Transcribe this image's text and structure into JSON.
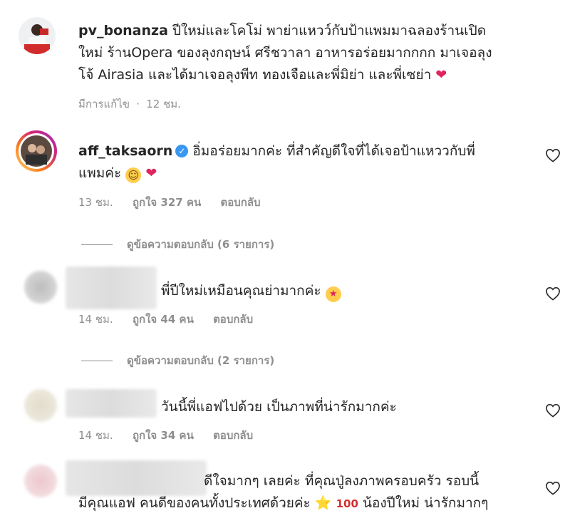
{
  "comments": [
    {
      "username": "pv_bonanza",
      "text_lines": [
        "ปีใหม่และโคโม่ พาย่าแหวว์กับป้าแพมมาฉลองร้านเปิด",
        "ใหม่ ร้านOpera ของลุงกฤษน์ ศรีชวาลา อาหารอร่อยมากกกก มาเจอลุง",
        "โจ้ Airasia และได้มาเจอลุงพีท ทองเจือและพี่มิย่า และพี่เซย่า"
      ],
      "emoji": "heart",
      "meta": {
        "edited": "มีการแก้ไข",
        "dot": "·",
        "time": "12 ชม."
      }
    },
    {
      "username": "aff_taksaorn",
      "verified": true,
      "text_lines": [
        "อิ่มอร่อยมากค่ะ ที่สำคัญดีใจที่ได้เจอป้าแหววกับพี่",
        "แพมค่ะ"
      ],
      "meta": {
        "time": "13 ชม.",
        "likes": "ถูกใจ 327 คน",
        "reply": "ตอบกลับ"
      },
      "view_replies": "ดูข้อความตอบกลับ (6 รายการ)"
    },
    {
      "text_lines": [
        "พี่ปีใหม่เหมือนคุณย่ามากค่ะ"
      ],
      "meta": {
        "time": "14 ชม.",
        "likes": "ถูกใจ 44 คน",
        "reply": "ตอบกลับ"
      },
      "view_replies": "ดูข้อความตอบกลับ (2 รายการ)"
    },
    {
      "text_lines": [
        "วันนี้พี่แอฟไปด้วย เป็นภาพที่น่ารักมากค่ะ"
      ],
      "meta": {
        "time": "14 ชม.",
        "likes": "ถูกใจ 34 คน",
        "reply": "ตอบกลับ"
      }
    },
    {
      "text_lines": [
        "ดีใจมากๆ เลยค่ะ ที่คุณปู่ลงภาพครอบครัว รอบนี้",
        "มีคุณแอฟ คนดีของคนทั้งประเทศด้วยค่ะ",
        "น้องปีใหม่ น่ารักมากๆ"
      ]
    }
  ],
  "icons": {
    "heart_outline": "heart-outline-icon",
    "verified": "verified-badge-icon"
  },
  "colors": {
    "meta_gray": "#8e8e8e",
    "text": "#262626",
    "verified_blue": "#3897f0"
  }
}
